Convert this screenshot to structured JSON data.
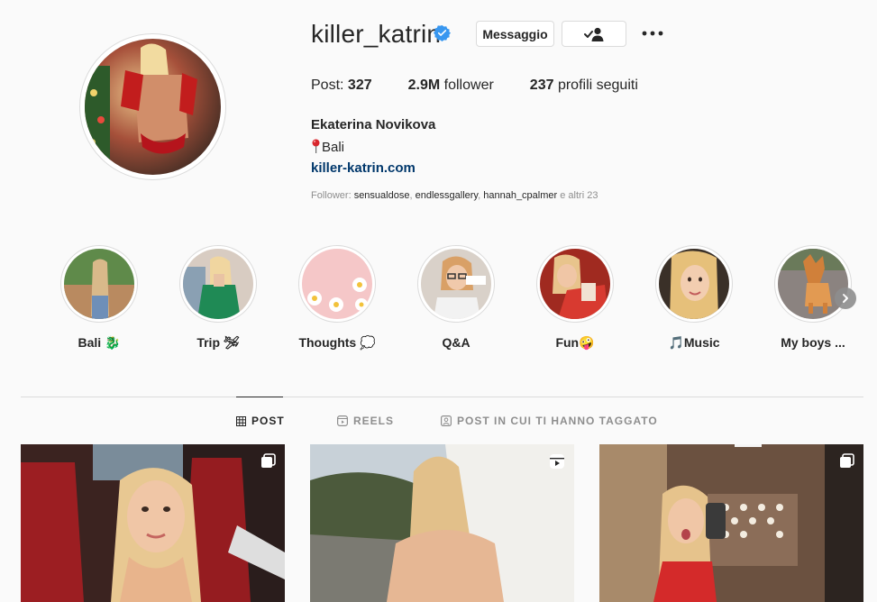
{
  "profile": {
    "username": "killer_katrin",
    "verified": true,
    "message_button": "Messaggio",
    "follow_button_icon": "following-person-check-icon",
    "more_icon": "more-dots-icon",
    "stats": {
      "posts_label": "Post:",
      "posts_value": "327",
      "followers_value": "2.9M",
      "followers_label": "follower",
      "following_value": "237",
      "following_label": "profili seguiti"
    },
    "full_name": "Ekaterina Novikova",
    "location_icon": "round-pushpin-emoji",
    "location": "Bali",
    "website": "killer-katrin.com",
    "followed_by": {
      "prefix": "Follower:",
      "accounts": [
        "sensualdose",
        "endlessgallery",
        "hannah_cpalmer"
      ],
      "separator": ",",
      "suffix": "e altri 23"
    }
  },
  "highlights": [
    {
      "label": "Bali",
      "emoji": "🐉",
      "image": "woman-garden"
    },
    {
      "label": "Trip",
      "emoji": "🛩",
      "image": "woman-green-jacket"
    },
    {
      "label": "Thoughts",
      "emoji": "💭",
      "image": "daisies-pink"
    },
    {
      "label": "Q&A",
      "emoji": "",
      "image": "woman-glasses"
    },
    {
      "label": "Fun",
      "emoji": "🤪",
      "image": "woman-red-sweater"
    },
    {
      "label": "Music",
      "emoji_prefix": "🎵",
      "image": "woman-selfie"
    },
    {
      "label": "My boys ...",
      "emoji": "",
      "image": "dog"
    }
  ],
  "highlights_next_icon": "chevron-right-icon",
  "tabs": [
    {
      "label": "POST",
      "icon": "grid-icon",
      "active": true
    },
    {
      "label": "REELS",
      "icon": "reels-icon",
      "active": false
    },
    {
      "label": "POST IN CUI TI HANNO TAGGATO",
      "icon": "tagged-icon",
      "active": false
    }
  ],
  "posts": [
    {
      "image": "woman-car-red-seats",
      "badge": "carousel-icon"
    },
    {
      "image": "woman-window-trees",
      "badge": "reels-icon"
    },
    {
      "image": "woman-mirror-selfie",
      "badge": "carousel-icon"
    }
  ],
  "colors": {
    "background": "#fafafa",
    "text": "#262626",
    "muted": "#8e8e8e",
    "link": "#00376b",
    "border": "#dbdbdb",
    "verified": "#3897f0"
  }
}
